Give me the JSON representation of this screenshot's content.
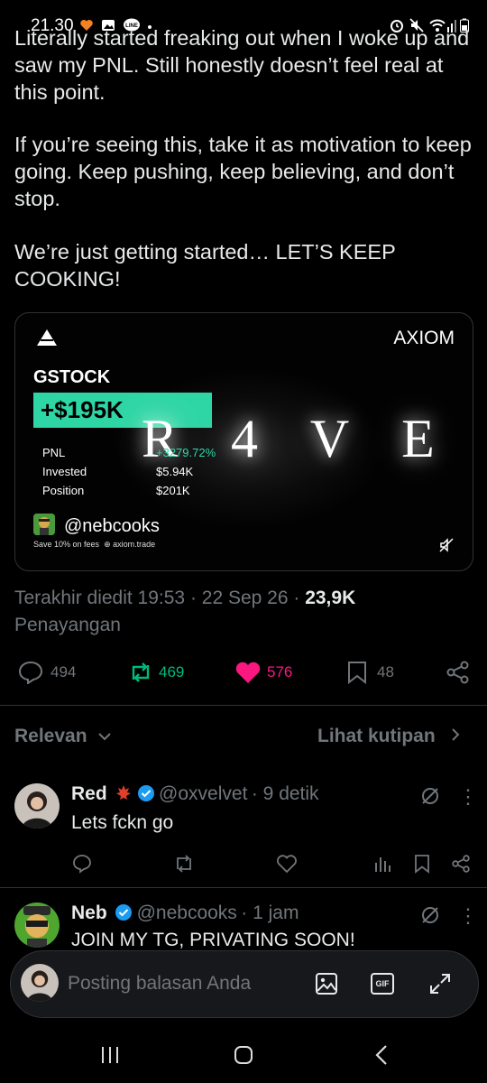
{
  "status_bar": {
    "time": "21.30",
    "line_badge": "LINE"
  },
  "post": {
    "paragraphs": [
      "Literally started freaking out when I woke up and saw my PNL. Still honestly doesn’t feel real at this point.",
      "If you’re seeing this, take it as motivation to keep going. Keep pushing, keep believing, and don’t stop.",
      "We’re just getting started… LET’S KEEP COOKING!"
    ],
    "card": {
      "brand": "AXIOM",
      "ticker": "GSTOCK",
      "pnl_big": "+$195K",
      "watermark": "R 4 V E",
      "rows": [
        {
          "label": "PNL",
          "value": "+3279.72%"
        },
        {
          "label": "Invested",
          "value": "$5.94K"
        },
        {
          "label": "Position",
          "value": "$201K"
        }
      ],
      "handle": "@nebcooks",
      "fees_text": "Save 10% on fees",
      "site": "axiom.trade",
      "accent": "#2fd6a5"
    },
    "meta": {
      "edited": "Terakhir diedit 19:53 · 22 Sep 26 · ",
      "views_count": "23,9K",
      "views_label": "Penayangan"
    },
    "actions": {
      "replies": "494",
      "reposts": "469",
      "likes": "576",
      "bookmarks": "48"
    }
  },
  "sort": {
    "relevance": "Relevan",
    "quotes": "Lihat kutipan"
  },
  "replies": [
    {
      "name": "Red",
      "handle": "@oxvelvet",
      "time": "· 9 detik",
      "text": "Lets fckn go"
    },
    {
      "name": "Neb",
      "handle": "@nebcooks",
      "time": "· 1 jam",
      "text": "JOIN MY TG, PRIVATING SOON!"
    }
  ],
  "composer": {
    "placeholder": "Posting balasan Anda",
    "gif": "GIF"
  },
  "colors": {
    "like": "#f91880",
    "repost": "#00ba7c",
    "verified": "#1d9bf0",
    "muted": "#71767b"
  }
}
